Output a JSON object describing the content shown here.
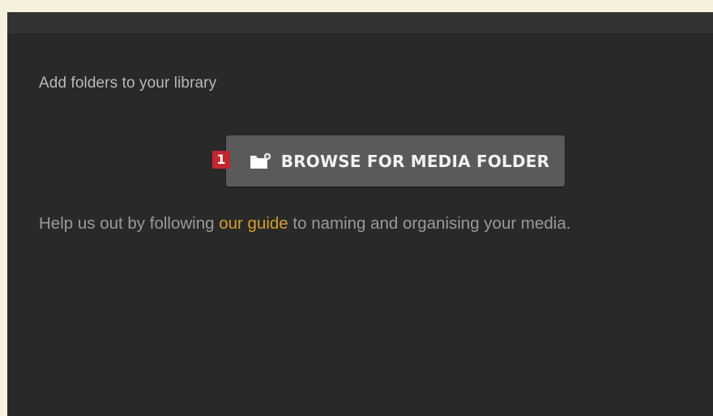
{
  "library": {
    "section_title": "Add folders to your library",
    "step_marker": "1",
    "browse_button_label": "BROWSE FOR MEDIA FOLDER",
    "browse_button_icon": "folder-add-icon",
    "help_text_before": "Help us out by following ",
    "help_link_text": "our guide",
    "help_text_after": " to naming and organising your media."
  },
  "colors": {
    "page_background": "#f6f1dc",
    "dialog_background": "#292929",
    "button_background": "#5a5a5a",
    "link_color": "#d59e2f",
    "marker_color": "#c1272d"
  }
}
